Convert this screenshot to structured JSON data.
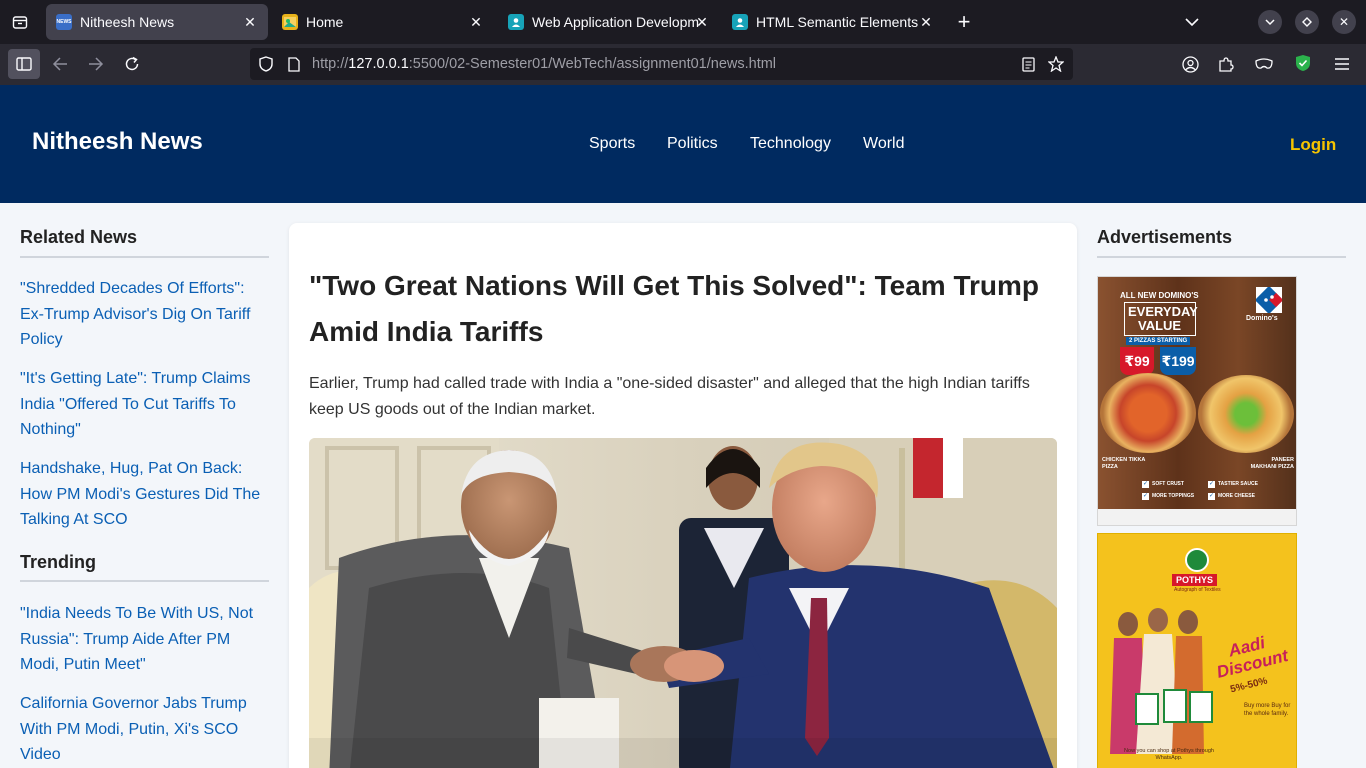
{
  "browser": {
    "tabs": [
      {
        "title": "Nitheesh News",
        "favicon_color": "#3a6ec7",
        "favicon_text": "NEWS"
      },
      {
        "title": "Home",
        "favicon_color": "#e8b21a",
        "favicon_text": ""
      },
      {
        "title": "Web Application Developm",
        "favicon_color": "#17a3b8",
        "favicon_text": ""
      },
      {
        "title": "HTML Semantic Elements",
        "favicon_color": "#17a3b8",
        "favicon_text": ""
      }
    ],
    "url_prefix": "http://",
    "url_host": "127.0.0.1",
    "url_path": ":5500/02-Semester01/WebTech/assignment01/news.html"
  },
  "site": {
    "brand": "Nitheesh News",
    "nav": [
      "Sports",
      "Politics",
      "Technology",
      "World"
    ],
    "login_label": "Login",
    "colors": {
      "header_bg": "#002a60",
      "accent": "#f5c400",
      "link": "#0a5fb4"
    }
  },
  "left_sidebar": {
    "related_title": "Related News",
    "related": [
      "\"Shredded Decades Of Efforts\": Ex-Trump Advisor's Dig On Tariff Policy",
      "\"It's Getting Late\": Trump Claims India \"Offered To Cut Tariffs To Nothing\"",
      "Handshake, Hug, Pat On Back: How PM Modi's Gestures Did The Talking At SCO"
    ],
    "trending_title": "Trending",
    "trending": [
      "\"India Needs To Be With US, Not Russia\": Trump Aide After PM Modi, Putin Meet\"",
      "California Governor Jabs Trump With PM Modi, Putin, Xi's SCO Video"
    ]
  },
  "article": {
    "headline": "\"Two Great Nations Will Get This Solved\": Team Trump Amid India Tariffs",
    "summary": "Earlier, Trump had called trade with India a \"one-sided disaster\" and alleged that the high Indian tariffs keep US goods out of the Indian market."
  },
  "ads": {
    "title": "Advertisements",
    "dominos": {
      "line1": "ALL NEW DOMINO'S",
      "line2": "EVERYDAY",
      "line3": "VALUE",
      "line4": "2 PIZZAS STARTING",
      "price_regular": "99",
      "price_medium": "199",
      "brand": "Domino's",
      "pizza_left": "CHICKEN TIKKA PIZZA",
      "pizza_right": "PANEER MAKHANI PIZZA",
      "checks": [
        "SOFT CRUST",
        "TASTIER SAUCE",
        "MORE TOPPINGS",
        "MORE CHEESE"
      ]
    },
    "pothys": {
      "brand": "POTHYS",
      "tagline": "Autograph of Textiles",
      "promo": "Aadi Discount",
      "discount": "5%-50%",
      "side_text": "Buy more Buy for the whole family.",
      "footer": "Now you can shop at Pothys through WhatsApp."
    }
  }
}
